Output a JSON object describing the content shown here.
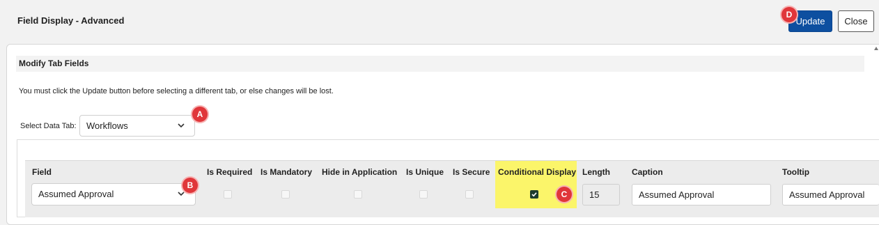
{
  "window": {
    "title": "Field Display - Advanced"
  },
  "toolbar": {
    "update_label": "Update",
    "close_label": "Close"
  },
  "section": {
    "title": "Modify Tab Fields"
  },
  "notice": "You must click the Update button before selecting a different tab, or else changes will be lost.",
  "data_tab": {
    "label": "Select Data Tab:",
    "selected": "Workflows"
  },
  "grid": {
    "headers": {
      "field": "Field",
      "is_required": "Is Required",
      "is_mandatory": "Is Mandatory",
      "hide_in_application": "Hide in Application",
      "is_unique": "Is Unique",
      "is_secure": "Is Secure",
      "conditional_display": "Conditional Display",
      "length": "Length",
      "caption": "Caption",
      "tooltip": "Tooltip"
    },
    "row": {
      "field": "Assumed Approval",
      "is_required": false,
      "is_mandatory": false,
      "hide_in_application": false,
      "is_unique": false,
      "is_secure": false,
      "conditional_display": true,
      "length": "15",
      "caption": "Assumed Approval",
      "tooltip": "Assumed Approval"
    }
  },
  "annotations": {
    "a": "A",
    "b": "B",
    "c": "C",
    "d": "D"
  },
  "colors": {
    "primary": "#0d4fa0",
    "highlight": "#fbf56a",
    "badge": "#e0363a",
    "checked": "#1e3d2e"
  }
}
